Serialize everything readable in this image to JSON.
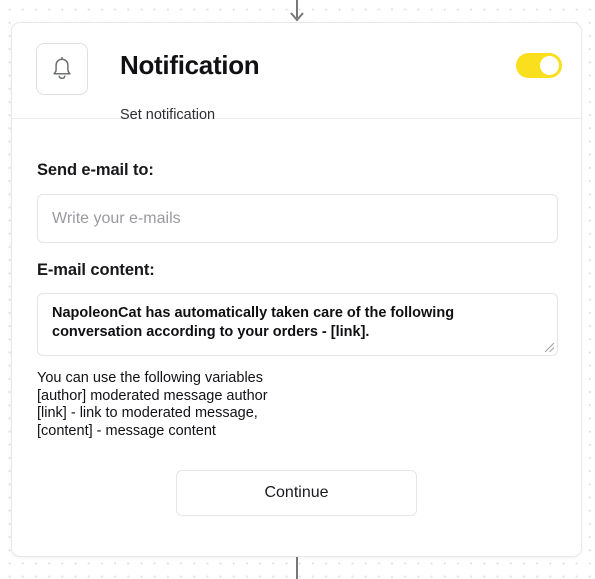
{
  "node": {
    "connector_in_icon": "arrow-down-icon",
    "connector_out": "vertical-line"
  },
  "header": {
    "icon": "bell-icon",
    "title": "Notification",
    "subtitle": "Set notification",
    "toggle": {
      "name": "notification-enabled-toggle",
      "state": "on",
      "on_color": "#fadf1e",
      "knob_color": "#ffffff"
    }
  },
  "form": {
    "email_to": {
      "label": "Send e-mail to:",
      "placeholder": "Write your e-mails",
      "value": ""
    },
    "email_content": {
      "label": "E-mail content:",
      "value": "NapoleonCat has automatically taken care of the following conversation according to your orders - [link].",
      "resize_handle_icon": "resize-grip-icon"
    },
    "helper": {
      "line1": "You can use the following variables",
      "line2": "[author] moderated message author",
      "line3": "[link] - link to moderated message,",
      "line4": "[content] - message content"
    }
  },
  "actions": {
    "continue_label": "Continue"
  }
}
